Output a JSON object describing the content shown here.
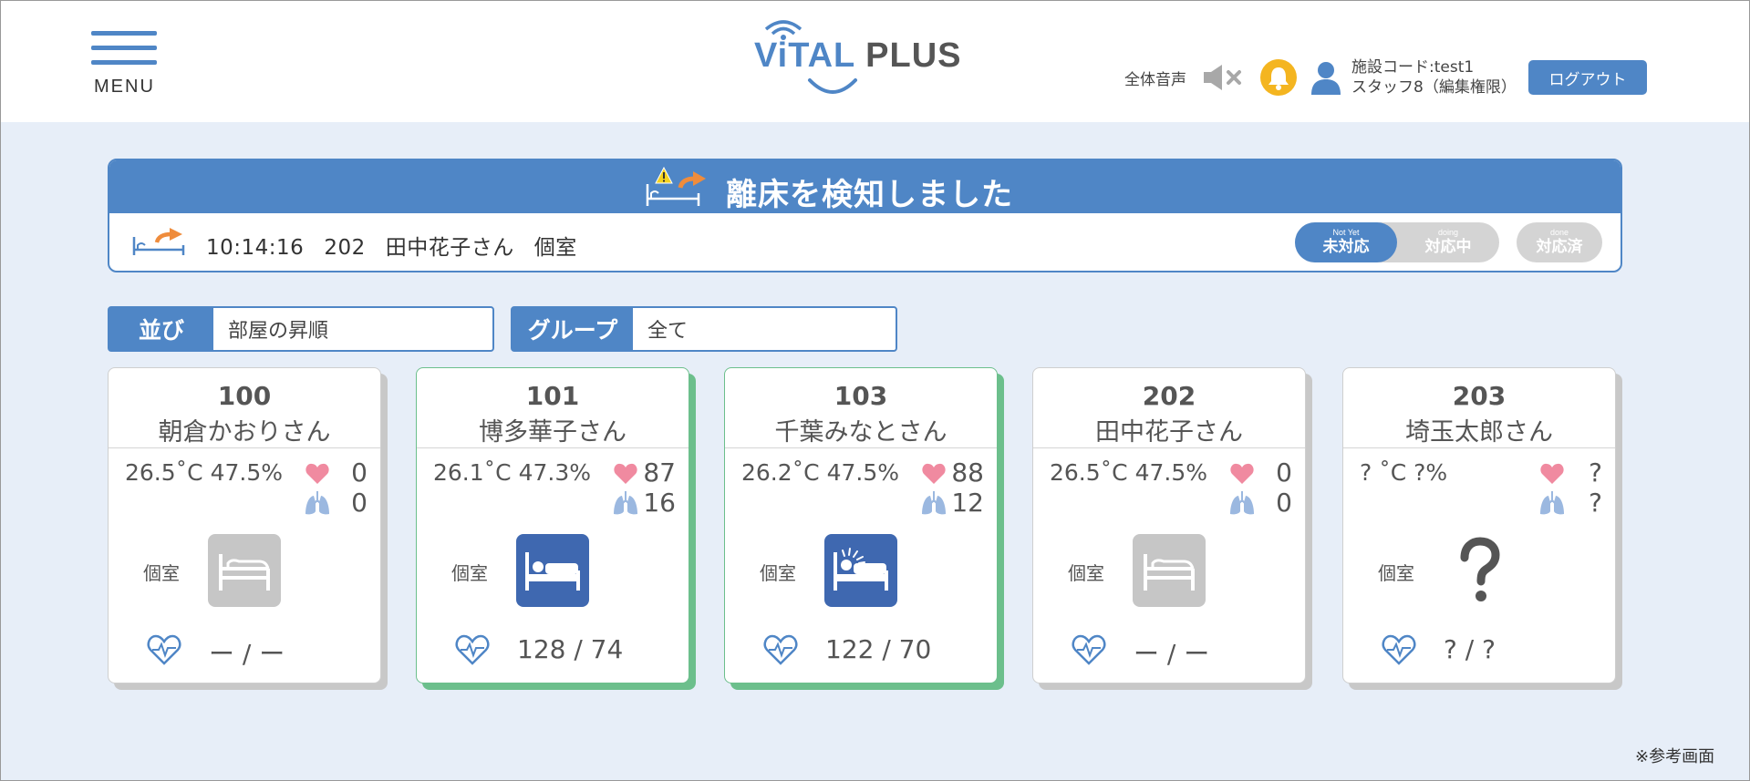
{
  "header": {
    "menu_label": "MENU",
    "logo": {
      "vital": "ViTAL",
      "plus": "PLUS"
    },
    "audio_label": "全体音声",
    "facility_code": "施設コード:test1",
    "staff": "スタッフ8（編集権限）",
    "logout_label": "ログアウト"
  },
  "alert": {
    "title": "離床を検知しました",
    "time": "10:14:16",
    "room": "202",
    "name": "田中花子さん",
    "room_type": "個室",
    "status": {
      "not_yet_en": "Not Yet",
      "not_yet": "未対応",
      "doing_en": "doing",
      "doing": "対応中",
      "done_en": "done",
      "done": "対応済",
      "current": "not_yet"
    }
  },
  "filters": {
    "sort_label": "並び",
    "sort_value": "部屋の昇順",
    "group_label": "グループ",
    "group_value": "全て"
  },
  "cards": [
    {
      "room": "100",
      "name": "朝倉かおりさん",
      "temp": "26.5˚C 47.5%",
      "hr": "0",
      "rr": "0",
      "room_type": "個室",
      "bed_state": "empty",
      "bp": "ー / ー",
      "active": false
    },
    {
      "room": "101",
      "name": "博多華子さん",
      "temp": "26.1˚C 47.3%",
      "hr": "87",
      "rr": "16",
      "room_type": "個室",
      "bed_state": "sleeping",
      "bp": "128 / 74",
      "active": true
    },
    {
      "room": "103",
      "name": "千葉みなとさん",
      "temp": "26.2˚C 47.5%",
      "hr": "88",
      "rr": "12",
      "room_type": "個室",
      "bed_state": "awake",
      "bp": "122 / 70",
      "active": true
    },
    {
      "room": "202",
      "name": "田中花子さん",
      "temp": "26.5˚C 47.5%",
      "hr": "0",
      "rr": "0",
      "room_type": "個室",
      "bed_state": "empty",
      "bp": "ー / ー",
      "active": false
    },
    {
      "room": "203",
      "name": "埼玉太郎さん",
      "temp": "? ˚C ?%",
      "hr": "?",
      "rr": "?",
      "room_type": "個室",
      "bed_state": "unknown",
      "bp": "? / ?",
      "active": false
    }
  ],
  "footer_note": "※参考画面",
  "colors": {
    "accent": "#4f86c6",
    "bed_active": "#3f68b0",
    "bed_empty": "#c6c6c6",
    "card_active": "#6cbf8c",
    "bell": "#f4b520",
    "heart": "#f08aa0",
    "lungs": "#9bb8e0",
    "background": "#e7eef8"
  }
}
